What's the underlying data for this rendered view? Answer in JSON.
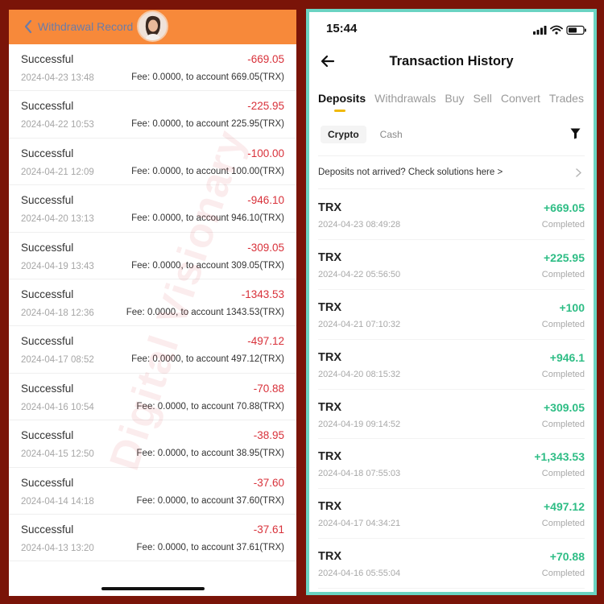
{
  "withdrawal_screen": {
    "title": "Withdrawal Record",
    "records": [
      {
        "status": "Successful",
        "amount": "-669.05",
        "datetime": "2024-04-23 13:48",
        "detail": "Fee: 0.0000, to account 669.05(TRX)"
      },
      {
        "status": "Successful",
        "amount": "-225.95",
        "datetime": "2024-04-22 10:53",
        "detail": "Fee: 0.0000, to account 225.95(TRX)"
      },
      {
        "status": "Successful",
        "amount": "-100.00",
        "datetime": "2024-04-21 12:09",
        "detail": "Fee: 0.0000, to account 100.00(TRX)"
      },
      {
        "status": "Successful",
        "amount": "-946.10",
        "datetime": "2024-04-20 13:13",
        "detail": "Fee: 0.0000, to account 946.10(TRX)"
      },
      {
        "status": "Successful",
        "amount": "-309.05",
        "datetime": "2024-04-19 13:43",
        "detail": "Fee: 0.0000, to account 309.05(TRX)"
      },
      {
        "status": "Successful",
        "amount": "-1343.53",
        "datetime": "2024-04-18 12:36",
        "detail": "Fee: 0.0000, to account 1343.53(TRX)"
      },
      {
        "status": "Successful",
        "amount": "-497.12",
        "datetime": "2024-04-17 08:52",
        "detail": "Fee: 0.0000, to account 497.12(TRX)"
      },
      {
        "status": "Successful",
        "amount": "-70.88",
        "datetime": "2024-04-16 10:54",
        "detail": "Fee: 0.0000, to account 70.88(TRX)"
      },
      {
        "status": "Successful",
        "amount": "-38.95",
        "datetime": "2024-04-15 12:50",
        "detail": "Fee: 0.0000, to account 38.95(TRX)"
      },
      {
        "status": "Successful",
        "amount": "-37.60",
        "datetime": "2024-04-14 14:18",
        "detail": "Fee: 0.0000, to account 37.60(TRX)"
      },
      {
        "status": "Successful",
        "amount": "-37.61",
        "datetime": "2024-04-13 13:20",
        "detail": "Fee: 0.0000, to account 37.61(TRX)"
      }
    ]
  },
  "history_screen": {
    "status_time": "15:44",
    "title": "Transaction History",
    "tabs": [
      "Deposits",
      "Withdrawals",
      "Buy",
      "Sell",
      "Convert",
      "Trades"
    ],
    "active_tab": "Deposits",
    "subtabs": [
      "Crypto",
      "Cash"
    ],
    "active_subtab": "Crypto",
    "notice": "Deposits not arrived? Check solutions here >",
    "records": [
      {
        "coin": "TRX",
        "amount": "+669.05",
        "datetime": "2024-04-23 08:49:28",
        "status": "Completed"
      },
      {
        "coin": "TRX",
        "amount": "+225.95",
        "datetime": "2024-04-22 05:56:50",
        "status": "Completed"
      },
      {
        "coin": "TRX",
        "amount": "+100",
        "datetime": "2024-04-21 07:10:32",
        "status": "Completed"
      },
      {
        "coin": "TRX",
        "amount": "+946.1",
        "datetime": "2024-04-20 08:15:32",
        "status": "Completed"
      },
      {
        "coin": "TRX",
        "amount": "+309.05",
        "datetime": "2024-04-19 09:14:52",
        "status": "Completed"
      },
      {
        "coin": "TRX",
        "amount": "+1,343.53",
        "datetime": "2024-04-18 07:55:03",
        "status": "Completed"
      },
      {
        "coin": "TRX",
        "amount": "+497.12",
        "datetime": "2024-04-17 04:34:21",
        "status": "Completed"
      },
      {
        "coin": "TRX",
        "amount": "+70.88",
        "datetime": "2024-04-16 05:55:04",
        "status": "Completed"
      }
    ]
  },
  "watermark": "Digital Visionary",
  "colors": {
    "background": "#7a1408",
    "left_header": "#f7893a",
    "withdraw_amount": "#d8313a",
    "deposit_amount": "#2ebd85",
    "right_border": "#6ad3c2",
    "tab_indicator": "#f0b90b"
  },
  "icons": {
    "left_back": "chevron-left-icon",
    "avatar": "user-avatar",
    "right_back": "arrow-left-icon",
    "filter": "filter-icon",
    "notice": "chevron-right-icon",
    "status": [
      "signal-icon",
      "wifi-icon",
      "battery-icon"
    ]
  }
}
